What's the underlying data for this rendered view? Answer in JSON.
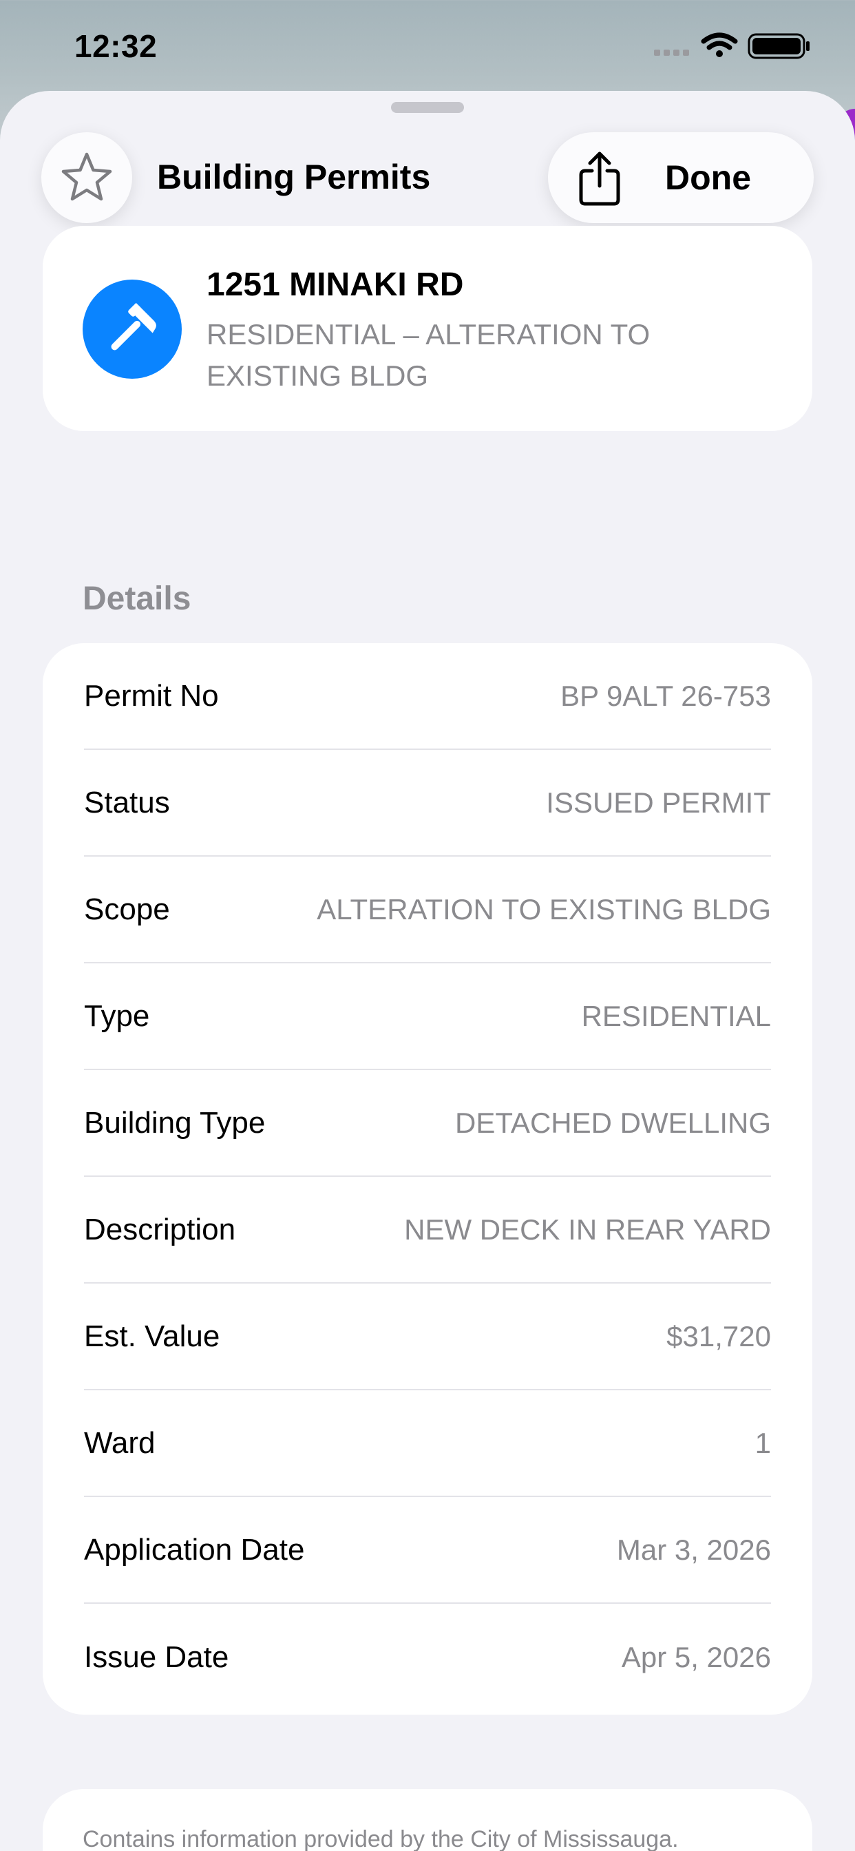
{
  "status_bar": {
    "time": "12:32",
    "icons": [
      "cellular-signal-icon",
      "wifi-icon",
      "battery-icon"
    ]
  },
  "sheet": {
    "title": "Building Permits",
    "favorite_icon": "star-icon",
    "share_icon": "share-icon",
    "done_label": "Done"
  },
  "permit": {
    "address": "1251 MINAKI RD",
    "kind": "RESIDENTIAL – ALTERATION TO EXISTING BLDG",
    "icon": "hammer-icon",
    "icon_color": "#0a84ff"
  },
  "details": {
    "header": "Details",
    "rows": [
      {
        "label": "Permit No",
        "value": "BP 9ALT 26-753"
      },
      {
        "label": "Status",
        "value": "ISSUED PERMIT"
      },
      {
        "label": "Scope",
        "value": "ALTERATION TO EXISTING BLDG"
      },
      {
        "label": "Type",
        "value": "RESIDENTIAL"
      },
      {
        "label": "Building Type",
        "value": "DETACHED DWELLING"
      },
      {
        "label": "Description",
        "value": "NEW DECK IN REAR YARD"
      },
      {
        "label": "Est. Value",
        "value": "$31,720"
      },
      {
        "label": "Ward",
        "value": "1"
      },
      {
        "label": "Application Date",
        "value": "Mar 3, 2026"
      },
      {
        "label": "Issue Date",
        "value": "Apr 5, 2026"
      }
    ]
  },
  "footer": {
    "attribution": "Contains information provided by the City of Mississauga."
  }
}
